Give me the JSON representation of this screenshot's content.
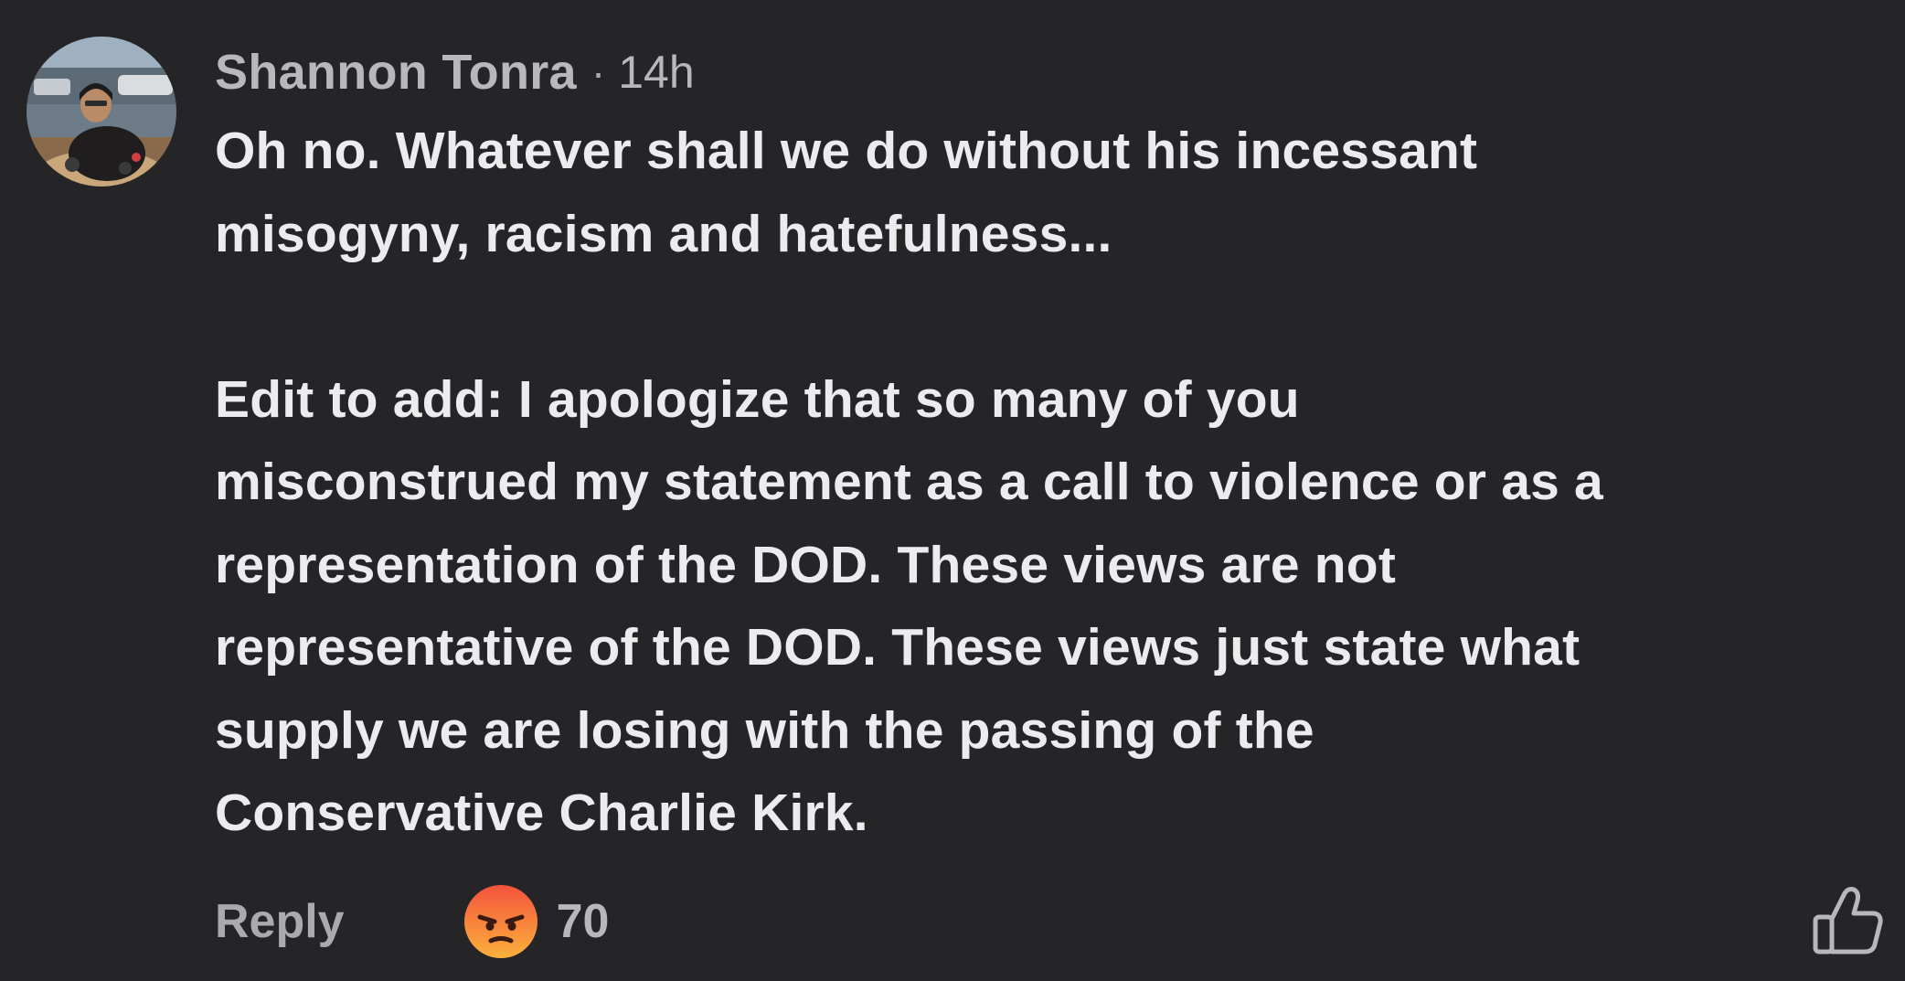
{
  "comment": {
    "author": "Shannon Tonra",
    "separator": "·",
    "timestamp": "14h",
    "paragraphs": [
      {
        "lines": [
          "Oh no. Whatever shall we do without his incessant",
          "misogyny, racism and hatefulness..."
        ]
      },
      {
        "lines": [
          "Edit to add: I apologize that so many of you",
          "misconstrued my statement as a call to violence or as a",
          "representation of the DOD. These views are not",
          "representative of the DOD. These views just state what",
          "supply we are losing with the passing of the",
          "Conservative Charlie Kirk."
        ]
      }
    ]
  },
  "actions": {
    "reply_label": "Reply",
    "reaction_icon": "angry-emoji-icon",
    "reaction_count": "70",
    "like_icon": "thumbs-up-icon"
  },
  "colors": {
    "background": "#252527",
    "text": "#ececee",
    "muted": "#b7b8ba",
    "angry_top": "#f5533d",
    "angry_bottom": "#fbb13c"
  }
}
